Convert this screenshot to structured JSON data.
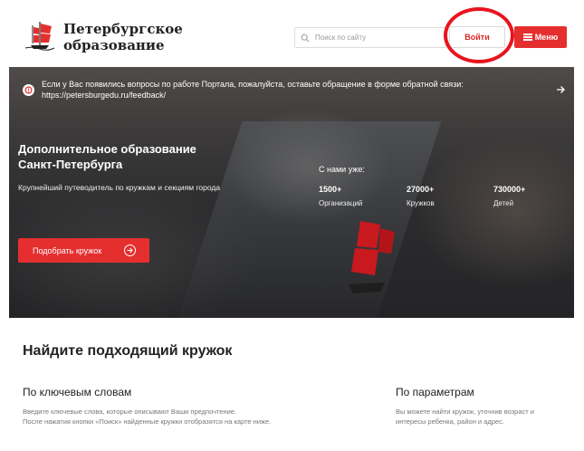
{
  "header": {
    "logo_line1": "Петербургское",
    "logo_line2": "образование",
    "search_placeholder": "Поиск по сайту",
    "login_label": "Войти",
    "menu_label": "Меню"
  },
  "notice": {
    "text": "Если у Вас появились вопросы по работе Портала, пожалуйста, оставьте обращение в форме обратной связи:",
    "link": "https://petersburgedu.ru/feedback/"
  },
  "hero": {
    "title_line1": "Дополнительное образование",
    "title_line2": "Санкт-Петербурга",
    "subtitle": "Крупнейший путеводитель по кружкам и секциям города",
    "stats_title": "С нами уже:",
    "stats": [
      {
        "num": "1500+",
        "label": "Организаций"
      },
      {
        "num": "27000+",
        "label": "Кружков"
      },
      {
        "num": "730000+",
        "label": "Детей"
      }
    ],
    "cta_label": "Подобрать кружок"
  },
  "find": {
    "title": "Найдите подходящий кружок",
    "by_keywords": {
      "title": "По ключевым словам",
      "text1": "Введите ключевые слова, которые описывают Ваши предпочтение.",
      "text2": "После нажатия кнопки «Поиск» найденные кружки отобразятся на карте ниже."
    },
    "by_params": {
      "title": "По параметрам",
      "text1": "Вы можете найти кружок, уточнив возраст и",
      "text2": "интересы ребенка, район и адрес."
    }
  },
  "colors": {
    "accent": "#e52f2f",
    "annotation_ring": "#e8141d"
  }
}
